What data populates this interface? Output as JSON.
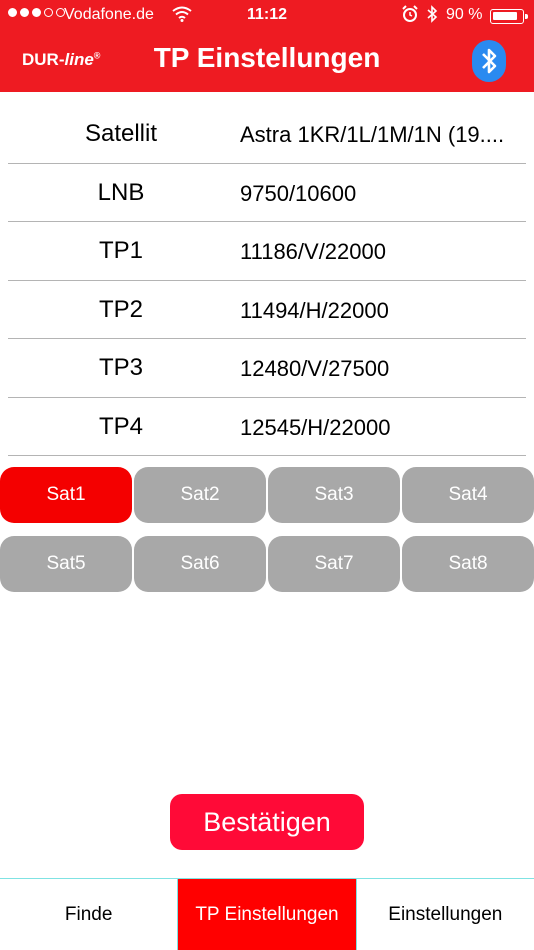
{
  "status_bar": {
    "carrier": "Vodafone.de",
    "time": "11:12",
    "battery": "90 %",
    "battery_level": 0.9,
    "signal_bars": 3,
    "icons": [
      "wifi-icon",
      "alarm-icon",
      "bluetooth-icon",
      "battery-icon"
    ]
  },
  "header": {
    "logo_brand": "DUR-",
    "logo_line": "line",
    "logo_mark": "®",
    "title": "TP Einstellungen",
    "bluetooth_icon": "bluetooth-icon",
    "color": "#ee1b22"
  },
  "settings": [
    {
      "label": "Satellit",
      "value": "Astra 1KR/1L/1M/1N (19...."
    },
    {
      "label": "LNB",
      "value": "9750/10600"
    },
    {
      "label": "TP1",
      "value": "11186/V/22000"
    },
    {
      "label": "TP2",
      "value": "11494/H/22000"
    },
    {
      "label": "TP3",
      "value": "12480/V/27500"
    },
    {
      "label": "TP4",
      "value": "12545/H/22000"
    }
  ],
  "sat_buttons": [
    {
      "label": "Sat1",
      "selected": true
    },
    {
      "label": "Sat2",
      "selected": false
    },
    {
      "label": "Sat3",
      "selected": false
    },
    {
      "label": "Sat4",
      "selected": false
    },
    {
      "label": "Sat5",
      "selected": false
    },
    {
      "label": "Sat6",
      "selected": false
    },
    {
      "label": "Sat7",
      "selected": false
    },
    {
      "label": "Sat8",
      "selected": false
    }
  ],
  "confirm_label": "Bestätigen",
  "tabs": [
    {
      "label": "Finde",
      "active": false
    },
    {
      "label": "TP Einstellungen",
      "active": true
    },
    {
      "label": "Einstellungen",
      "active": false
    }
  ],
  "colors": {
    "accent_red": "#ee1b22",
    "selected_sat": "#f40000",
    "inactive_sat": "#a8a8a8",
    "confirm_button": "#ff0a37",
    "bluetooth_blue": "#2a8af0"
  }
}
